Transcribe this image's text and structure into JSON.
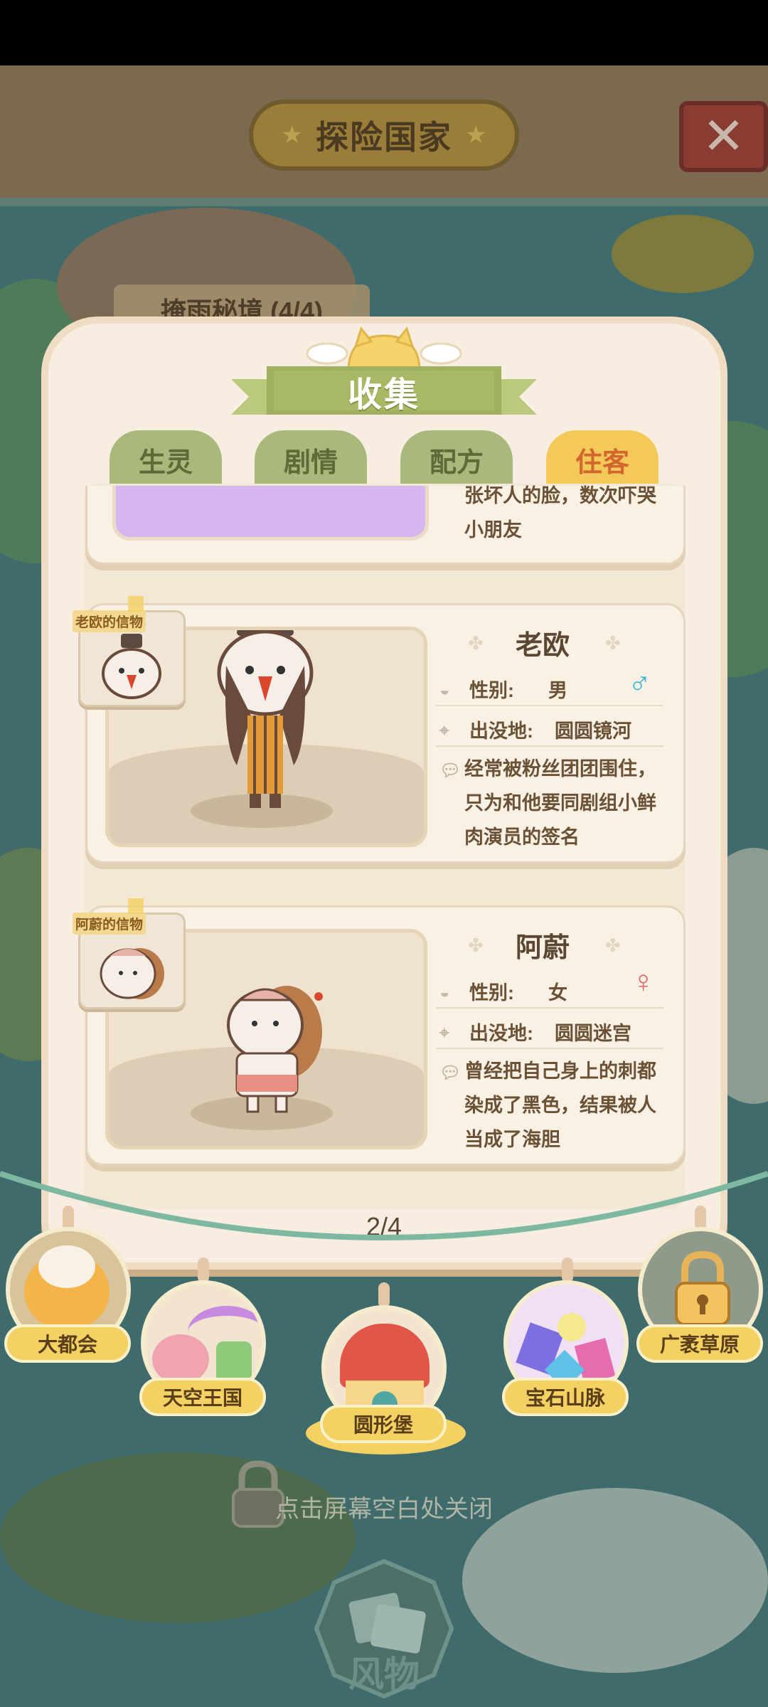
{
  "header": {
    "title": "探险国家"
  },
  "background_location": "掩雨秘境 (4/4)",
  "panel": {
    "title": "收集"
  },
  "tabs": [
    {
      "label": "生灵",
      "active": false
    },
    {
      "label": "剧情",
      "active": false
    },
    {
      "label": "配方",
      "active": false
    },
    {
      "label": "住客",
      "active": true
    }
  ],
  "partial_card": {
    "desc_lines": [
      "张坏人的脸，数次吓哭",
      "小朋友"
    ]
  },
  "residents": [
    {
      "token_label": "老欧的信物",
      "name": "老欧",
      "gender_label": "性别:",
      "gender": "男",
      "gender_symbol": "♂",
      "haunt_label": "出没地:",
      "haunt": "圆圆镜河",
      "desc_lines": [
        "经常被粉丝团团围住，",
        "只为和他要同剧组小鲜",
        "肉演员的签名"
      ]
    },
    {
      "token_label": "阿蔚的信物",
      "name": "阿蔚",
      "gender_label": "性别:",
      "gender": "女",
      "gender_symbol": "♀",
      "haunt_label": "出没地:",
      "haunt": "圆圆迷宫",
      "desc_lines": [
        "曾经把自己身上的刺都",
        "染成了黑色，结果被人",
        "当成了海胆"
      ]
    }
  ],
  "pager": "2/4",
  "regions": [
    {
      "label": "大都会",
      "locked": false
    },
    {
      "label": "天空王国",
      "locked": false
    },
    {
      "label": "圆形堡",
      "locked": false,
      "selected": true
    },
    {
      "label": "宝石山脉",
      "locked": false
    },
    {
      "label": "广袤草原",
      "locked": true
    }
  ],
  "close_hint": "点击屏幕空白处关闭",
  "bottom_button": "风物",
  "colors": {
    "accent": "#f4c95a",
    "male": "#3fb6d6",
    "female": "#e46a6a"
  }
}
